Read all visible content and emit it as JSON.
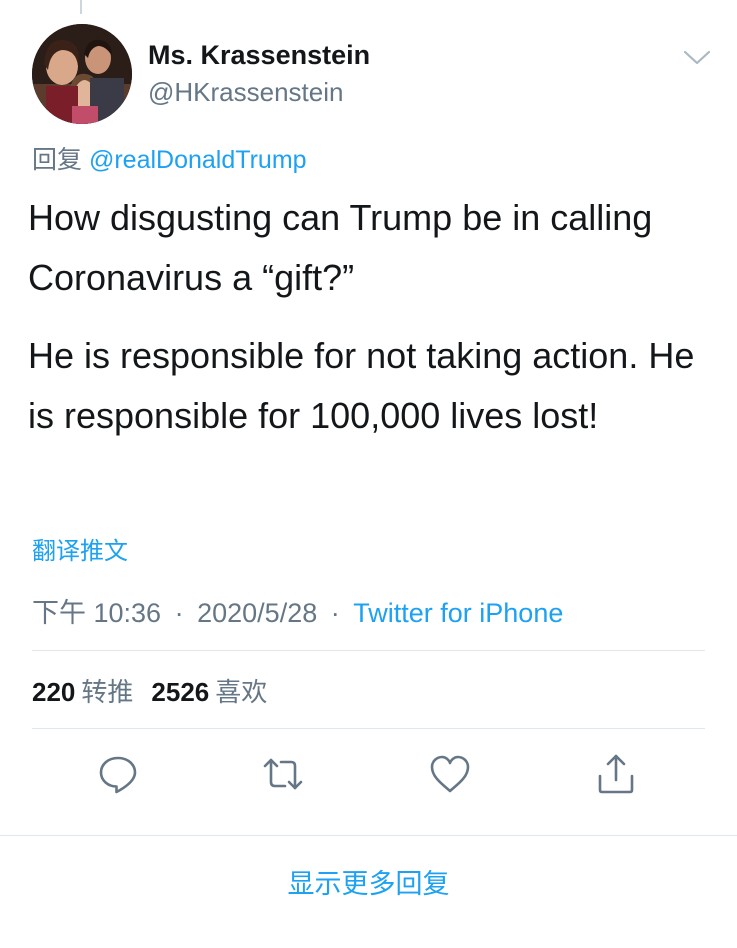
{
  "tweet": {
    "author": {
      "display_name": "Ms. Krassenstein",
      "handle": "@HKrassenstein"
    },
    "reply_prefix": "回复",
    "reply_to": "@realDonaldTrump",
    "paragraphs": [
      "How disgusting can Trump be in calling Coronavirus a “gift?”",
      "He is responsible for not taking action.  He is responsible for 100,000 lives lost!"
    ],
    "translate_label": "翻译推文",
    "meta": {
      "time": "下午 10:36",
      "separator": "·",
      "date": "2020/5/28",
      "source": "Twitter for iPhone"
    },
    "stats": {
      "retweets_count": "220",
      "retweets_label": "转推",
      "likes_count": "2526",
      "likes_label": "喜欢"
    },
    "actions": {
      "reply_icon": "reply-icon",
      "retweet_icon": "retweet-icon",
      "like_icon": "heart-icon",
      "share_icon": "share-icon"
    }
  },
  "footer": {
    "show_more_label": "显示更多回复"
  },
  "colors": {
    "accent": "#1da1f2",
    "secondary_text": "#657786",
    "primary_text": "#14171a",
    "icon": "#657786",
    "divider": "#e1e8ed"
  }
}
